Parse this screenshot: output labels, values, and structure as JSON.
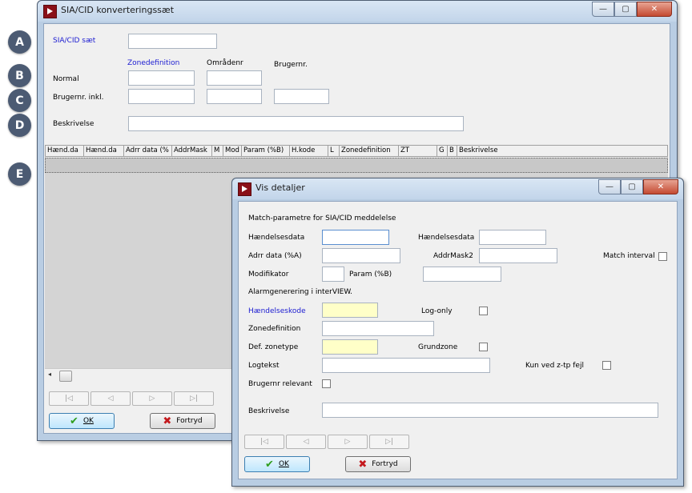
{
  "callouts": [
    "A",
    "B",
    "C",
    "D",
    "E"
  ],
  "main_window": {
    "title": "SIA/CID konverteringssæt",
    "window_controls": {
      "minimize": "—",
      "maximize": "▢",
      "close": "✕"
    },
    "fields": {
      "sia_cid_set_label": "SIA/CID sæt",
      "col_zonedef": "Zonedefinition",
      "col_omraadenr": "Områdenr",
      "col_brugernr": "Brugernr.",
      "row_normal": "Normal",
      "row_brugernr_inkl": "Brugernr. inkl.",
      "beskrivelse_label": "Beskrivelse"
    },
    "table_columns": [
      "Hænd.da",
      "Hænd.da",
      "Adrr data (%",
      "AddrMask",
      "M",
      "Mod",
      "Param (%B)",
      "H.kode",
      "L",
      "Zonedefinition",
      "ZT",
      "G",
      "B",
      "Beskrivelse"
    ],
    "nav_buttons": [
      "|◁",
      "◁",
      "▷",
      "▷|"
    ],
    "ok_label": "OK",
    "cancel_label": "Fortryd"
  },
  "detail_window": {
    "title": "Vis detaljer",
    "window_controls": {
      "minimize": "—",
      "maximize": "▢",
      "close": "✕"
    },
    "section_match": "Match-parametre for SIA/CID meddelelse",
    "haendelsesdata_1": "Hændelsesdata",
    "haendelsesdata_2": "Hændelsesdata",
    "adrr_data": "Adrr data (%A)",
    "addrmask2": "AddrMask2",
    "match_interval": "Match interval",
    "modifikator": "Modifikator",
    "param_b": "Param (%B)",
    "section_alarm": "Alarmgenerering i interVIEW.",
    "haendelseskode": "Hændelseskode",
    "log_only": "Log-only",
    "zonedefinition": "Zonedefinition",
    "def_zonetype": "Def. zonetype",
    "grundzone": "Grundzone",
    "logtekst": "Logtekst",
    "kun_ved": "Kun ved z-tp fejl",
    "brugernr_relevant": "Brugernr relevant",
    "beskrivelse": "Beskrivelse",
    "nav_buttons": [
      "|◁",
      "◁",
      "▷",
      "▷|"
    ],
    "ok_label": "OK",
    "cancel_label": "Fortryd"
  },
  "colors": {
    "label_blue": "#1b1bd1",
    "required_yellow": "#ffffc8",
    "title_bg": "#c9dbef"
  }
}
